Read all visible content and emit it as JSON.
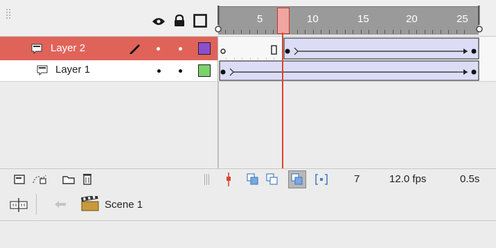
{
  "timeline": {
    "ruler": {
      "ticks": [
        "5",
        "10",
        "15",
        "20",
        "25"
      ]
    },
    "current_frame": 7,
    "layers": [
      {
        "name": "Layer 2",
        "selected": true,
        "color": "#8a4fcf",
        "editing": true,
        "visible": true,
        "locked": false
      },
      {
        "name": "Layer 1",
        "selected": false,
        "color": "#7ad36b",
        "editing": false,
        "visible": true,
        "locked": false
      }
    ],
    "status": {
      "frame": "7",
      "fps": "12.0 fps",
      "time": "0.5s"
    }
  },
  "scene_bar": {
    "scene_label": "Scene 1"
  },
  "colors": {
    "selected_row": "#e0635a",
    "playhead": "#d9452b",
    "tween_fill": "#dcdcf6",
    "ruler_bg": "#9a9a9a"
  }
}
